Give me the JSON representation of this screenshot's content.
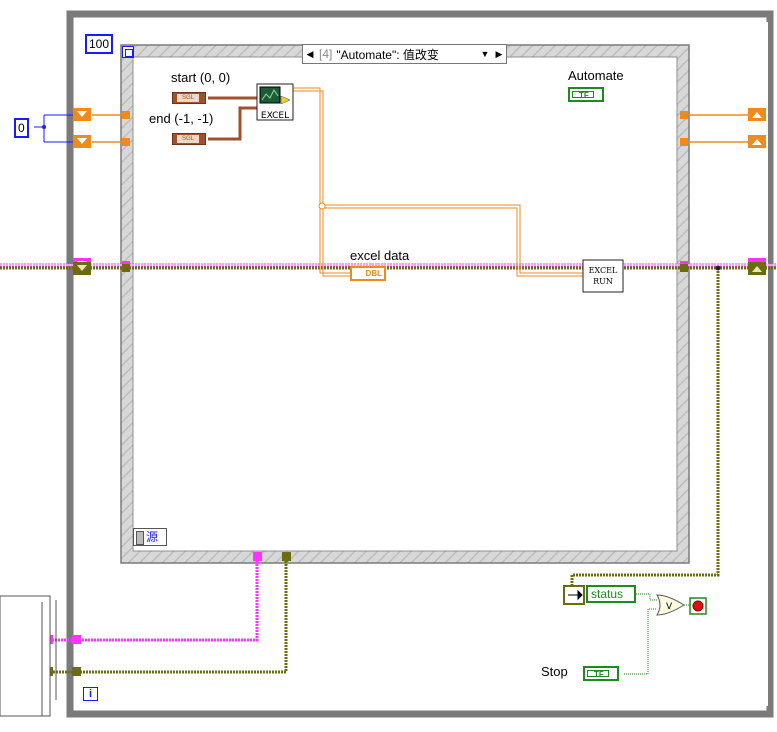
{
  "loop": {
    "timeout_constant": "100",
    "iteration_terminal": "i"
  },
  "init_constant": "0",
  "event_structure": {
    "selector_index": "[4]",
    "selector_text": "\"Automate\": 值改变",
    "event_source_label": "源"
  },
  "labels": {
    "start": "start (0, 0)",
    "end": "end (-1, -1)",
    "automate": "Automate",
    "excel_data": "excel data",
    "stop": "Stop"
  },
  "terminals": {
    "bool_tf": "TF",
    "dbl": "DBL",
    "cluster": "SGL",
    "status": "status",
    "or_gate": "V"
  },
  "subvis": {
    "excel_read": "EXCEL",
    "excel_run_line1": "EXCEL",
    "excel_run_line2": "RUN"
  },
  "colors": {
    "while_loop_frame": "#7a7a7a",
    "event_frame": "#8f8f8f",
    "integer_wire": "#f08a1c",
    "cluster_wire": "#a0502d",
    "array_wire_pink": "#ff33ff",
    "error_wire": "#6b6b10",
    "boolean_wire": "#1f8a1f",
    "constant_border": "#1a1aff"
  }
}
